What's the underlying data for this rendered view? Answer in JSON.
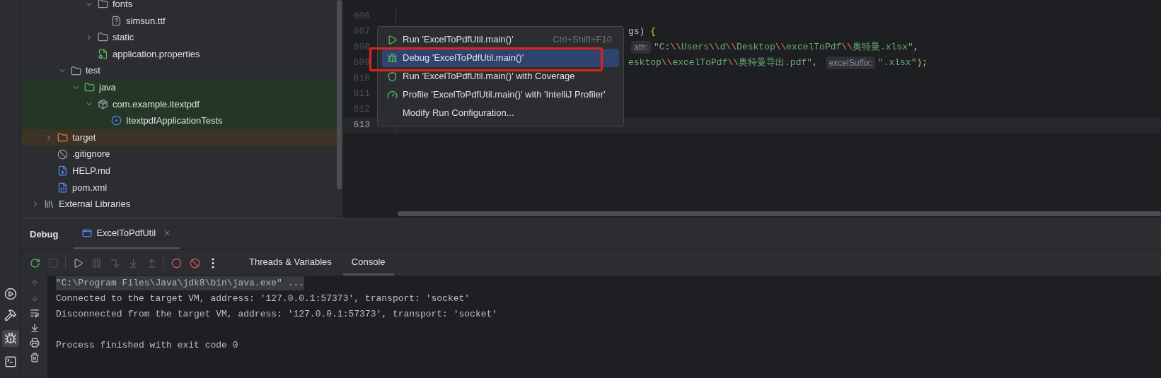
{
  "project_tree": {
    "items": [
      {
        "children": [
          {
            "children": [
              {
                "children": [
                  {
                    "children": [
                      {
                        "label": "fonts",
                        "kind": "folder",
                        "expanded": true,
                        "children": [
                          {
                            "label": "simsun.ttf",
                            "kind": "unknown_file"
                          }
                        ]
                      },
                      {
                        "label": "static",
                        "kind": "folder",
                        "expanded": false
                      },
                      {
                        "label": "application.properties",
                        "kind": "properties"
                      }
                    ]
                  }
                ]
              },
              {
                "label": "test",
                "kind": "folder",
                "expanded": true,
                "children": [
                  {
                    "label": "java",
                    "kind": "test_root",
                    "expanded": true,
                    "color": "#253627",
                    "children": [
                      {
                        "label": "com.example.itextpdf",
                        "kind": "package",
                        "expanded": true,
                        "color": "#253627",
                        "children": [
                          {
                            "label": "ItextpdfApplicationTests",
                            "kind": "test_class",
                            "color": "#253627"
                          }
                        ]
                      }
                    ]
                  }
                ]
              }
            ]
          },
          {
            "label": "target",
            "kind": "excluded_folder",
            "expanded": false,
            "color": "#3d3223"
          },
          {
            "label": ".gitignore",
            "kind": "ignore_file"
          },
          {
            "label": "HELP.md",
            "kind": "markdown"
          },
          {
            "label": "pom.xml",
            "kind": "maven"
          }
        ]
      },
      {
        "label": "External Libraries",
        "kind": "libraries",
        "expanded": false
      }
    ]
  },
  "editor": {
    "lines": [
      {
        "number": "606",
        "current": false
      },
      {
        "number": "607",
        "current": false,
        "tokens": [
          {
            "kind": "plain",
            "text": "gs) "
          },
          {
            "kind": "brace",
            "text": "{"
          }
        ]
      },
      {
        "number": "608",
        "current": false,
        "tokens": [
          {
            "kind": "hint",
            "text": "ath:"
          },
          {
            "kind": "string",
            "text": "\"C:"
          },
          {
            "kind": "escape",
            "text": "\\\\"
          },
          {
            "kind": "string",
            "text": "Users"
          },
          {
            "kind": "escape",
            "text": "\\\\"
          },
          {
            "kind": "string",
            "text": "d"
          },
          {
            "kind": "escape",
            "text": "\\\\"
          },
          {
            "kind": "string",
            "text": "Desktop"
          },
          {
            "kind": "escape",
            "text": "\\\\"
          },
          {
            "kind": "string",
            "text": "excelToPdf"
          },
          {
            "kind": "escape",
            "text": "\\\\"
          },
          {
            "kind": "string",
            "text": "奥特曼.xlsx\""
          },
          {
            "kind": "plain",
            "text": ","
          }
        ]
      },
      {
        "number": "609",
        "current": false,
        "tokens": [
          {
            "kind": "string",
            "text": "esktop"
          },
          {
            "kind": "escape",
            "text": "\\\\"
          },
          {
            "kind": "string",
            "text": "excelToPdf"
          },
          {
            "kind": "escape",
            "text": "\\\\"
          },
          {
            "kind": "string",
            "text": "奥特曼导出.pdf\""
          },
          {
            "kind": "plain",
            "text": ", "
          },
          {
            "kind": "hint",
            "text": "excelSuffix:"
          },
          {
            "kind": "string",
            "text": "\".xlsx\""
          },
          {
            "kind": "brace",
            "text": ")"
          },
          {
            "kind": "plain",
            "text": ";"
          }
        ]
      },
      {
        "number": "610",
        "current": false
      },
      {
        "number": "611",
        "current": false
      },
      {
        "number": "612",
        "current": false
      },
      {
        "number": "613",
        "current": true
      }
    ]
  },
  "context_menu": {
    "items": [
      {
        "kind": "run",
        "label": "Run 'ExcelToPdfUtil.main()'",
        "shortcut": "Ctrl+Shift+F10",
        "selected": false
      },
      {
        "kind": "debug",
        "label": "Debug 'ExcelToPdfUtil.main()'",
        "selected": true
      },
      {
        "kind": "coverage",
        "label": "Run 'ExcelToPdfUtil.main()' with Coverage",
        "selected": false
      },
      {
        "kind": "profile",
        "label": "Profile 'ExcelToPdfUtil.main()' with 'IntelliJ Profiler'",
        "selected": false
      },
      {
        "kind": "plain",
        "label": "Modify Run Configuration...",
        "selected": false
      }
    ]
  },
  "debug_panel": {
    "title": "Debug",
    "session_tabs": [
      {
        "label": "ExcelToPdfUtil",
        "selected": true
      }
    ],
    "toolbar": [
      {
        "kind": "rerun",
        "disabled": false
      },
      {
        "kind": "stop",
        "disabled": true
      },
      {
        "kind": "separator"
      },
      {
        "kind": "resume",
        "disabled": false
      },
      {
        "kind": "pause",
        "disabled": true
      },
      {
        "kind": "step_over",
        "disabled": true
      },
      {
        "kind": "step_into",
        "disabled": true
      },
      {
        "kind": "step_out",
        "disabled": true
      },
      {
        "kind": "separator"
      },
      {
        "kind": "breakpoints",
        "disabled": false
      },
      {
        "kind": "mute",
        "disabled": false
      },
      {
        "kind": "more",
        "disabled": false
      }
    ],
    "view_tabs": [
      {
        "label": "Threads & Variables",
        "selected": false
      },
      {
        "label": "Console",
        "selected": true
      }
    ],
    "console": [
      {
        "kind": "command",
        "text": "\"C:\\Program Files\\Java\\jdk8\\bin\\java.exe\" ..."
      },
      {
        "kind": "output",
        "text": "Connected to the target VM, address: '127.0.0.1:57373', transport: 'socket'"
      },
      {
        "kind": "output",
        "text": "Disconnected from the target VM, address: '127.0.0.1:57373', transport: 'socket'"
      },
      {
        "kind": "blank"
      },
      {
        "kind": "output",
        "text": "Process finished with exit code 0"
      }
    ]
  }
}
